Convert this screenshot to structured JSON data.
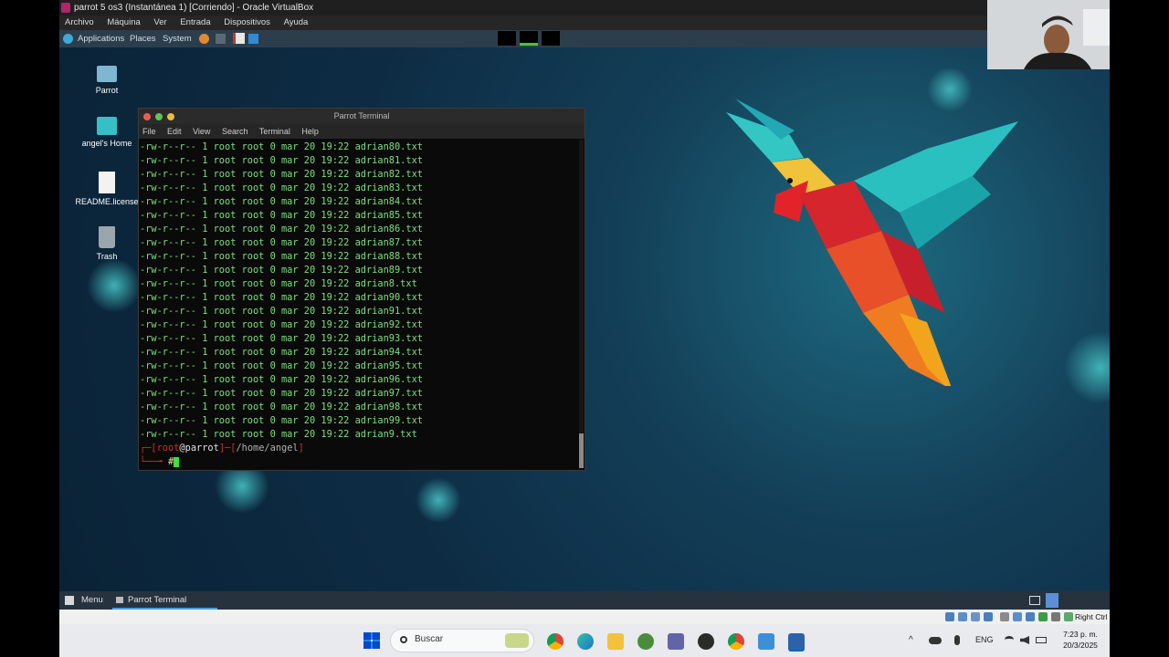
{
  "vbox": {
    "title": "parrot 5 os3 (Instantánea 1) [Corriendo] - Oracle VirtualBox",
    "menu": [
      "Archivo",
      "Máquina",
      "Ver",
      "Entrada",
      "Dispositivos",
      "Ayuda"
    ]
  },
  "guest_panel": {
    "applications": "Applications",
    "places": "Places",
    "system": "System"
  },
  "desktop": {
    "icons": [
      "Parrot",
      "angel's Home",
      "README.license",
      "Trash"
    ]
  },
  "terminal": {
    "title": "Parrot Terminal",
    "menu": [
      "File",
      "Edit",
      "View",
      "Search",
      "Terminal",
      "Help"
    ],
    "lines": [
      "-rw-r--r-- 1 root root 0 mar 20 19:22 adrian80.txt",
      "-rw-r--r-- 1 root root 0 mar 20 19:22 adrian81.txt",
      "-rw-r--r-- 1 root root 0 mar 20 19:22 adrian82.txt",
      "-rw-r--r-- 1 root root 0 mar 20 19:22 adrian83.txt",
      "-rw-r--r-- 1 root root 0 mar 20 19:22 adrian84.txt",
      "-rw-r--r-- 1 root root 0 mar 20 19:22 adrian85.txt",
      "-rw-r--r-- 1 root root 0 mar 20 19:22 adrian86.txt",
      "-rw-r--r-- 1 root root 0 mar 20 19:22 adrian87.txt",
      "-rw-r--r-- 1 root root 0 mar 20 19:22 adrian88.txt",
      "-rw-r--r-- 1 root root 0 mar 20 19:22 adrian89.txt",
      "-rw-r--r-- 1 root root 0 mar 20 19:22 adrian8.txt",
      "-rw-r--r-- 1 root root 0 mar 20 19:22 adrian90.txt",
      "-rw-r--r-- 1 root root 0 mar 20 19:22 adrian91.txt",
      "-rw-r--r-- 1 root root 0 mar 20 19:22 adrian92.txt",
      "-rw-r--r-- 1 root root 0 mar 20 19:22 adrian93.txt",
      "-rw-r--r-- 1 root root 0 mar 20 19:22 adrian94.txt",
      "-rw-r--r-- 1 root root 0 mar 20 19:22 adrian95.txt",
      "-rw-r--r-- 1 root root 0 mar 20 19:22 adrian96.txt",
      "-rw-r--r-- 1 root root 0 mar 20 19:22 adrian97.txt",
      "-rw-r--r-- 1 root root 0 mar 20 19:22 adrian98.txt",
      "-rw-r--r-- 1 root root 0 mar 20 19:22 adrian99.txt",
      "-rw-r--r-- 1 root root 0 mar 20 19:22 adrian9.txt"
    ],
    "prompt_user": "root",
    "prompt_host": "@parrot",
    "prompt_path": "/home/angel",
    "prompt_symbol": "#"
  },
  "guest_taskbar": {
    "menu": "Menu",
    "window": "Parrot Terminal"
  },
  "vbox_status": {
    "host_key": "Right Ctrl"
  },
  "windows_taskbar": {
    "search_placeholder": "Buscar",
    "language": "ENG",
    "time": "7:23 p. m.",
    "date": "20/3/2025"
  },
  "colors": {
    "terminal_text": "#7be07b",
    "prompt_red": "#d0302a",
    "panel": "#2c3e4c"
  }
}
